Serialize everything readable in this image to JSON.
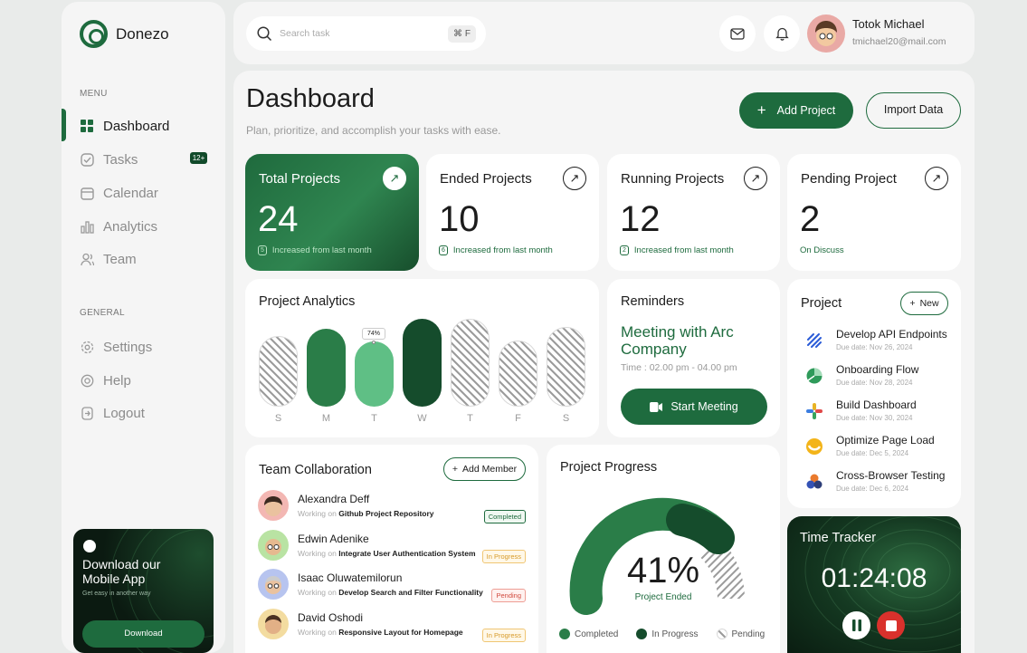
{
  "brand": {
    "name": "Donezo"
  },
  "sidebar": {
    "menu_label": "MENU",
    "general_label": "GENERAL",
    "items": [
      {
        "label": "Dashboard",
        "icon": "grid-icon",
        "active": true
      },
      {
        "label": "Tasks",
        "icon": "tasks-icon",
        "badge": "12+"
      },
      {
        "label": "Calendar",
        "icon": "calendar-icon"
      },
      {
        "label": "Analytics",
        "icon": "analytics-icon"
      },
      {
        "label": "Team",
        "icon": "team-icon"
      }
    ],
    "general_items": [
      {
        "label": "Settings",
        "icon": "gear-icon"
      },
      {
        "label": "Help",
        "icon": "help-icon"
      },
      {
        "label": "Logout",
        "icon": "logout-icon"
      }
    ],
    "app_promo": {
      "title": "Download our Mobile App",
      "subtitle": "Get easy in another way",
      "button": "Download"
    }
  },
  "topbar": {
    "search_placeholder": "Search task",
    "shortcut": "⌘ F",
    "user": {
      "name": "Totok Michael",
      "email": "tmichael20@mail.com"
    }
  },
  "header": {
    "title": "Dashboard",
    "subtitle": "Plan, prioritize, and accomplish your tasks with ease.",
    "add_button": "Add Project",
    "import_button": "Import Data"
  },
  "stats": [
    {
      "title": "Total Projects",
      "value": "24",
      "tag": "5",
      "foot": "Increased from last month"
    },
    {
      "title": "Ended Projects",
      "value": "10",
      "tag": "6",
      "foot": "Increased from last month"
    },
    {
      "title": "Running Projects",
      "value": "12",
      "tag": "2",
      "foot": "Increased from last month"
    },
    {
      "title": "Pending Project",
      "value": "2",
      "foot": "On Discuss"
    }
  ],
  "analytics": {
    "title": "Project Analytics",
    "tooltip": "74%",
    "days": [
      "S",
      "M",
      "T",
      "W",
      "T",
      "F",
      "S"
    ]
  },
  "reminders": {
    "title": "Reminders",
    "event": "Meeting with Arc Company",
    "time": "Time : 02.00 pm - 04.00 pm",
    "button": "Start Meeting"
  },
  "projects": {
    "title": "Project",
    "new_button": "New",
    "items": [
      {
        "name": "Develop API Endpoints",
        "due": "Due date: Nov 26, 2024"
      },
      {
        "name": "Onboarding Flow",
        "due": "Due date: Nov 28, 2024"
      },
      {
        "name": "Build Dashboard",
        "due": "Due date: Nov 30, 2024"
      },
      {
        "name": "Optimize Page Load",
        "due": "Due date: Dec 5, 2024"
      },
      {
        "name": "Cross-Browser Testing",
        "due": "Due date: Dec 6, 2024"
      }
    ]
  },
  "team": {
    "title": "Team Collaboration",
    "add_button": "Add Member",
    "working_on": "Working on",
    "members": [
      {
        "name": "Alexandra Deff",
        "task": "Github Project Repository",
        "status": "Completed"
      },
      {
        "name": "Edwin Adenike",
        "task": "Integrate User Authentication System",
        "status": "In Progress"
      },
      {
        "name": "Isaac Oluwatemilorun",
        "task": "Develop Search and Filter Functionality",
        "status": "Pending"
      },
      {
        "name": "David Oshodi",
        "task": "Responsive Layout for Homepage",
        "status": "In Progress"
      }
    ]
  },
  "progress": {
    "title": "Project Progress",
    "value": "41%",
    "label": "Project Ended",
    "legend": [
      "Completed",
      "In Progress",
      "Pending"
    ]
  },
  "time_tracker": {
    "title": "Time Tracker",
    "time": "01:24:08"
  },
  "colors": {
    "primary": "#1e6b3e",
    "dark": "#114a2a",
    "light": "#5fbf85"
  }
}
